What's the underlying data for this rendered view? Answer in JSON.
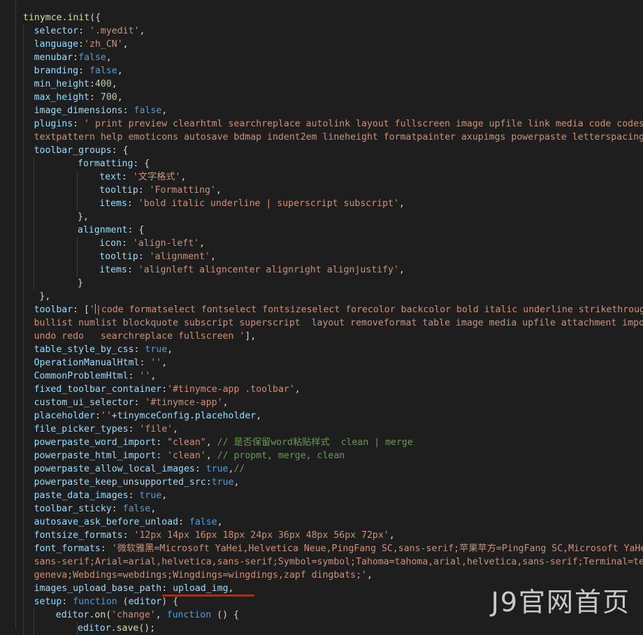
{
  "editor": {
    "watermark": "J9官网首页",
    "lines": [
      {
        "indent": 0,
        "guides": 0,
        "tokens": [
          [
            "fn",
            "tinymce.init"
          ],
          [
            "pun",
            "({"
          ]
        ]
      },
      {
        "indent": 1,
        "guides": 1,
        "tokens": [
          [
            "key",
            "selector"
          ],
          [
            "pun",
            ": "
          ],
          [
            "str",
            "'.myedit'"
          ],
          [
            "pun",
            ","
          ]
        ]
      },
      {
        "indent": 1,
        "guides": 1,
        "tokens": [
          [
            "key",
            "language"
          ],
          [
            "pun",
            ":"
          ],
          [
            "str",
            "'zh_CN'"
          ],
          [
            "pun",
            ","
          ]
        ]
      },
      {
        "indent": 1,
        "guides": 1,
        "tokens": [
          [
            "key",
            "menubar"
          ],
          [
            "pun",
            ":"
          ],
          [
            "kw",
            "false"
          ],
          [
            "pun",
            ","
          ]
        ]
      },
      {
        "indent": 1,
        "guides": 1,
        "tokens": [
          [
            "key",
            "branding"
          ],
          [
            "pun",
            ": "
          ],
          [
            "kw",
            "false"
          ],
          [
            "pun",
            ","
          ]
        ]
      },
      {
        "indent": 1,
        "guides": 1,
        "tokens": [
          [
            "key",
            "min_height"
          ],
          [
            "pun",
            ":"
          ],
          [
            "num",
            "400"
          ],
          [
            "pun",
            ","
          ]
        ]
      },
      {
        "indent": 1,
        "guides": 1,
        "tokens": [
          [
            "key",
            "max_height"
          ],
          [
            "pun",
            ": "
          ],
          [
            "num",
            "700"
          ],
          [
            "pun",
            ","
          ]
        ]
      },
      {
        "indent": 1,
        "guides": 1,
        "tokens": [
          [
            "key",
            "image_dimensions"
          ],
          [
            "pun",
            ": "
          ],
          [
            "kw",
            "false"
          ],
          [
            "pun",
            ","
          ]
        ]
      },
      {
        "indent": 1,
        "guides": 1,
        "tokens": [
          [
            "key",
            "plugins"
          ],
          [
            "pun",
            ": "
          ],
          [
            "str",
            "' print preview clearhtml searchreplace autolink layout fullscreen image upfile link media code codesamp"
          ]
        ]
      },
      {
        "indent": 1,
        "guides": 1,
        "tokens": [
          [
            "str",
            "textpattern help emoticons autosave bdmap indent2em lineheight formatpainter axupimgs powerpaste letterspacing ima"
          ]
        ]
      },
      {
        "indent": 1,
        "guides": 1,
        "tokens": [
          [
            "key",
            "toolbar_groups"
          ],
          [
            "pun",
            ": {"
          ]
        ]
      },
      {
        "indent": 5,
        "guides": 2,
        "tokens": [
          [
            "key",
            "formatting"
          ],
          [
            "pun",
            ": {"
          ]
        ]
      },
      {
        "indent": 7,
        "guides": 3,
        "tokens": [
          [
            "key",
            "text"
          ],
          [
            "pun",
            ": "
          ],
          [
            "str",
            "'文字格式'"
          ],
          [
            "pun",
            ","
          ]
        ]
      },
      {
        "indent": 7,
        "guides": 3,
        "tokens": [
          [
            "key",
            "tooltip"
          ],
          [
            "pun",
            ": "
          ],
          [
            "str",
            "'Formatting'"
          ],
          [
            "pun",
            ","
          ]
        ]
      },
      {
        "indent": 7,
        "guides": 3,
        "tokens": [
          [
            "key",
            "items"
          ],
          [
            "pun",
            ": "
          ],
          [
            "str",
            "'bold italic underline | superscript subscript'"
          ],
          [
            "pun",
            ","
          ]
        ]
      },
      {
        "indent": 5,
        "guides": 2,
        "tokens": [
          [
            "pun",
            "},"
          ]
        ]
      },
      {
        "indent": 5,
        "guides": 2,
        "tokens": [
          [
            "key",
            "alignment"
          ],
          [
            "pun",
            ": {"
          ]
        ]
      },
      {
        "indent": 7,
        "guides": 3,
        "tokens": [
          [
            "key",
            "icon"
          ],
          [
            "pun",
            ": "
          ],
          [
            "str",
            "'align-left'"
          ],
          [
            "pun",
            ","
          ]
        ]
      },
      {
        "indent": 7,
        "guides": 3,
        "tokens": [
          [
            "key",
            "tooltip"
          ],
          [
            "pun",
            ": "
          ],
          [
            "str",
            "'alignment'"
          ],
          [
            "pun",
            ","
          ]
        ]
      },
      {
        "indent": 7,
        "guides": 3,
        "tokens": [
          [
            "key",
            "items"
          ],
          [
            "pun",
            ": "
          ],
          [
            "str",
            "'alignleft aligncenter alignright alignjustify'"
          ],
          [
            "pun",
            ","
          ]
        ]
      },
      {
        "indent": 5,
        "guides": 2,
        "tokens": [
          [
            "pun",
            "}"
          ]
        ]
      },
      {
        "indent": 1.5,
        "guides": 1,
        "tokens": [
          [
            "pun",
            "},"
          ]
        ]
      },
      {
        "indent": 1,
        "guides": 1,
        "tokens": [
          [
            "key",
            "toolbar"
          ],
          [
            "pun",
            ": ["
          ],
          [
            "str",
            "'"
          ],
          [
            "cursor",
            ""
          ],
          [
            "str",
            "|code formatselect fontselect fontsizeselect forecolor backcolor bold italic underline strikethrough l"
          ]
        ]
      },
      {
        "indent": 1,
        "guides": 1,
        "tokens": [
          [
            "str",
            "bullist numlist blockquote subscript superscript  layout removeformat table image media upfile attachment importw"
          ]
        ]
      },
      {
        "indent": 1,
        "guides": 1,
        "tokens": [
          [
            "str",
            "undo redo   searchreplace fullscreen '"
          ],
          [
            "pun",
            "],"
          ]
        ]
      },
      {
        "indent": 1,
        "guides": 1,
        "tokens": [
          [
            "key",
            "table_style_by_css"
          ],
          [
            "pun",
            ": "
          ],
          [
            "kw",
            "true"
          ],
          [
            "pun",
            ","
          ]
        ]
      },
      {
        "indent": 1,
        "guides": 1,
        "tokens": [
          [
            "key",
            "OperationManualHtml"
          ],
          [
            "pun",
            ": "
          ],
          [
            "str",
            "''"
          ],
          [
            "pun",
            ","
          ]
        ]
      },
      {
        "indent": 1,
        "guides": 1,
        "tokens": [
          [
            "key",
            "CommonProblemHtml"
          ],
          [
            "pun",
            ": "
          ],
          [
            "str",
            "''"
          ],
          [
            "pun",
            ","
          ]
        ]
      },
      {
        "indent": 1,
        "guides": 1,
        "tokens": [
          [
            "key",
            "fixed_toolbar_container"
          ],
          [
            "pun",
            ":"
          ],
          [
            "str",
            "'#tinymce-app .toolbar'"
          ],
          [
            "pun",
            ","
          ]
        ]
      },
      {
        "indent": 1,
        "guides": 1,
        "tokens": [
          [
            "key",
            "custom_ui_selector"
          ],
          [
            "pun",
            ": "
          ],
          [
            "str",
            "'#tinymce-app'"
          ],
          [
            "pun",
            ","
          ]
        ]
      },
      {
        "indent": 1,
        "guides": 1,
        "tokens": [
          [
            "key",
            "placeholder"
          ],
          [
            "pun",
            ":"
          ],
          [
            "str",
            "''"
          ],
          [
            "pun",
            "+"
          ],
          [
            "key",
            "tinymceConfig"
          ],
          [
            "pun",
            "."
          ],
          [
            "key",
            "placeholder"
          ],
          [
            "pun",
            ","
          ]
        ]
      },
      {
        "indent": 1,
        "guides": 1,
        "tokens": [
          [
            "key",
            "file_picker_types"
          ],
          [
            "pun",
            ": "
          ],
          [
            "str",
            "'file'"
          ],
          [
            "pun",
            ","
          ]
        ]
      },
      {
        "indent": 1,
        "guides": 1,
        "tokens": [
          [
            "key",
            "powerpaste_word_import"
          ],
          [
            "pun",
            ": "
          ],
          [
            "str",
            "\"clean\""
          ],
          [
            "pun",
            ", "
          ],
          [
            "cmt",
            "// 是否保留word粘贴样式  clean | merge"
          ]
        ]
      },
      {
        "indent": 1,
        "guides": 1,
        "tokens": [
          [
            "key",
            "powerpaste_html_import"
          ],
          [
            "pun",
            ": "
          ],
          [
            "str",
            "'clean'"
          ],
          [
            "pun",
            ", "
          ],
          [
            "cmt",
            "// propmt, merge, clean"
          ]
        ]
      },
      {
        "indent": 1,
        "guides": 1,
        "tokens": [
          [
            "key",
            "powerpaste_allow_local_images"
          ],
          [
            "pun",
            ": "
          ],
          [
            "kw",
            "true"
          ],
          [
            "pun",
            ","
          ],
          [
            "cmt",
            "//"
          ]
        ]
      },
      {
        "indent": 1,
        "guides": 1,
        "tokens": [
          [
            "key",
            "powerpaste_keep_unsupported_src"
          ],
          [
            "pun",
            ":"
          ],
          [
            "kw",
            "true"
          ],
          [
            "pun",
            ","
          ]
        ]
      },
      {
        "indent": 1,
        "guides": 1,
        "tokens": [
          [
            "key",
            "paste_data_images"
          ],
          [
            "pun",
            ": "
          ],
          [
            "kw",
            "true"
          ],
          [
            "pun",
            ","
          ]
        ]
      },
      {
        "indent": 1,
        "guides": 1,
        "tokens": [
          [
            "key",
            "toolbar_sticky"
          ],
          [
            "pun",
            ": "
          ],
          [
            "kw",
            "false"
          ],
          [
            "pun",
            ","
          ]
        ]
      },
      {
        "indent": 1,
        "guides": 1,
        "tokens": [
          [
            "key",
            "autosave_ask_before_unload"
          ],
          [
            "pun",
            ": "
          ],
          [
            "kw",
            "false"
          ],
          [
            "pun",
            ","
          ]
        ]
      },
      {
        "indent": 1,
        "guides": 1,
        "tokens": [
          [
            "key",
            "fontsize_formats"
          ],
          [
            "pun",
            ": "
          ],
          [
            "str",
            "'12px 14px 16px 18px 24px 36px 48px 56px 72px'"
          ],
          [
            "pun",
            ","
          ]
        ]
      },
      {
        "indent": 1,
        "guides": 1,
        "tokens": [
          [
            "key",
            "font_formats"
          ],
          [
            "pun",
            ": "
          ],
          [
            "str",
            "'微软雅黑=Microsoft YaHei,Helvetica Neue,PingFang SC,sans-serif;苹果苹方=PingFang SC,Microsoft YaHei,"
          ]
        ]
      },
      {
        "indent": 1,
        "guides": 1,
        "tokens": [
          [
            "str",
            "sans-serif;Arial=arial,helvetica,sans-serif;Symbol=symbol;Tahoma=tahoma,arial,helvetica,sans-serif;Terminal=termi"
          ]
        ]
      },
      {
        "indent": 1,
        "guides": 1,
        "tokens": [
          [
            "str",
            "geneva;Webdings=webdings;Wingdings=wingdings,zapf dingbats;'"
          ],
          [
            "pun",
            ","
          ]
        ]
      },
      {
        "indent": 1,
        "guides": 1,
        "tokens": [
          [
            "key",
            "images_upload_base_path"
          ],
          [
            "pun",
            ": "
          ],
          [
            "key",
            "upload_img"
          ],
          [
            "pun",
            ","
          ]
        ]
      },
      {
        "indent": 1,
        "guides": 1,
        "tokens": [
          [
            "key",
            "setup"
          ],
          [
            "pun",
            ": "
          ],
          [
            "kw",
            "function"
          ],
          [
            "pun",
            " ("
          ],
          [
            "key",
            "editor"
          ],
          [
            "pun",
            ") {"
          ]
        ]
      },
      {
        "indent": 3,
        "guides": 2,
        "tokens": [
          [
            "key",
            "editor"
          ],
          [
            "pun",
            "."
          ],
          [
            "fn",
            "on"
          ],
          [
            "pun",
            "("
          ],
          [
            "str",
            "'change'"
          ],
          [
            "pun",
            ", "
          ],
          [
            "kw",
            "function"
          ],
          [
            "pun",
            " () {"
          ]
        ]
      },
      {
        "indent": 5,
        "guides": 3,
        "tokens": [
          [
            "key",
            "editor"
          ],
          [
            "pun",
            "."
          ],
          [
            "fn",
            "save"
          ],
          [
            "pun",
            "();"
          ]
        ]
      }
    ]
  }
}
